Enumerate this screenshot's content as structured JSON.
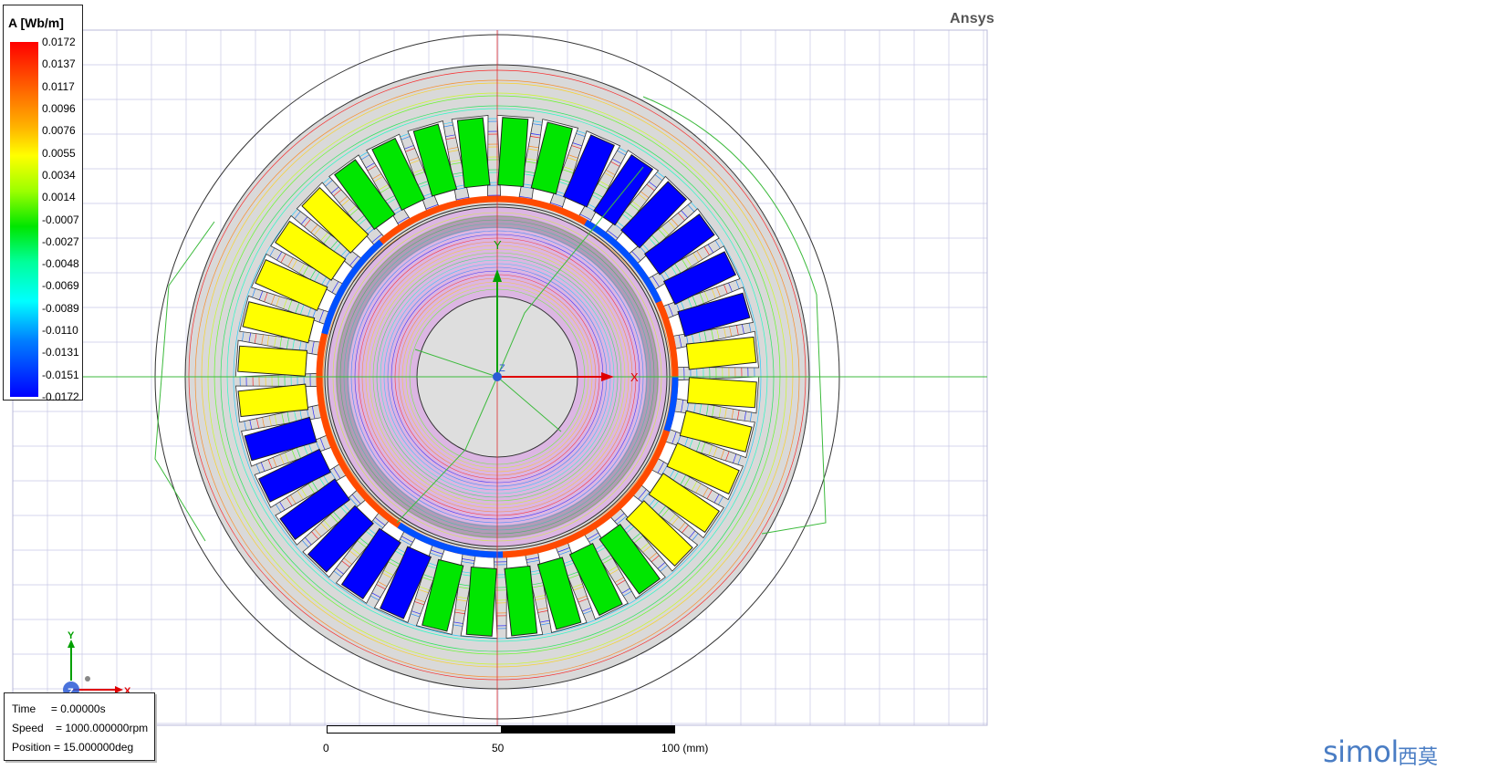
{
  "app": {
    "brand": "Ansys"
  },
  "legend": {
    "title": "A [Wb/m]",
    "labels": [
      "0.0172",
      "0.0137",
      "0.0117",
      "0.0096",
      "0.0076",
      "0.0055",
      "0.0034",
      "0.0014",
      "-0.0007",
      "-0.0027",
      "-0.0048",
      "-0.0069",
      "-0.0089",
      "-0.0110",
      "-0.0131",
      "-0.0151",
      "-0.0172"
    ]
  },
  "axes": {
    "x": "X",
    "y": "Y",
    "z": "Z"
  },
  "triad": {
    "x": "X",
    "y": "Y",
    "z": "Z"
  },
  "info": {
    "time": "Time     = 0.00000s",
    "speed": "Speed    = 1000.000000rpm",
    "position": "Position = 15.000000deg"
  },
  "scale": {
    "labels": [
      "0",
      "50",
      "100 (mm)"
    ]
  },
  "watermark": {
    "text": "simol",
    "cn": "西莫"
  },
  "colors": {
    "coil_green": "#00e600",
    "coil_blue": "#0000ff",
    "coil_yellow": "#ffff00",
    "core": "#d9d9d9",
    "grid": "#c8c8e6",
    "axis_line": "#3cba3c"
  }
}
